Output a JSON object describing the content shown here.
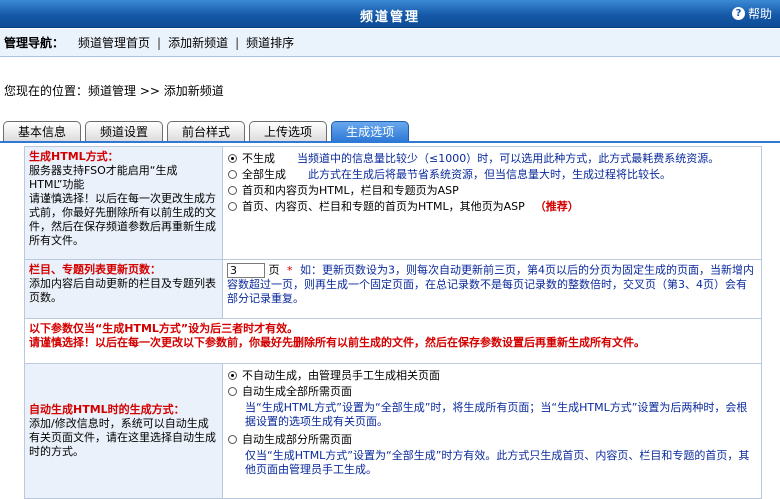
{
  "header": {
    "title": "频道管理",
    "help_label": "帮助"
  },
  "nav": {
    "label": "管理导航：",
    "links": [
      "频道管理首页",
      "添加新频道",
      "频道排序"
    ]
  },
  "location": "您现在的位置：频道管理 >> 添加新频道",
  "tabs": [
    "基本信息",
    "频道设置",
    "前台样式",
    "上传选项",
    "生成选项"
  ],
  "active_tab": "生成选项",
  "html_mode": {
    "title": "生成HTML方式：",
    "desc": "服务器支持FSO才能启用“生成HTML”功能\n请谨慎选择！以后在每一次更改生成方式前，你最好先删除所有以前生成的文件，然后在保存频道参数后再重新生成所有文件。",
    "options": [
      {
        "label": "不生成",
        "desc": "当频道中的信息量比较少（≤1000）时，可以选用此种方式，此方式最耗费系统资源。",
        "checked": true
      },
      {
        "label": "全部生成",
        "desc": "此方式在生成后将最节省系统资源，但当信息量大时，生成过程将比较长。",
        "checked": false
      },
      {
        "label": "首页和内容页为HTML，栏目和专题页为ASP",
        "desc": "",
        "checked": false
      },
      {
        "label": "首页、内容页、栏目和专题的首页为HTML，其他页为ASP",
        "desc": "",
        "recommend": "（推荐）",
        "checked": false
      }
    ]
  },
  "update_pages": {
    "title": "栏目、专题列表更新页数：",
    "desc": "添加内容后自动更新的栏目及专题列表页数。",
    "value": "3",
    "unit": "页",
    "star": "*",
    "note": "如：更新页数设为3，则每次自动更新前三页，第4页以后的分页为固定生成的页面，当新增内容数超过一页，则再生成一个固定页面，在总记录数不是每页记录数的整数倍时，交叉页（第3、4页）会有部分记录重复。"
  },
  "notice": {
    "line1": "以下参数仅当“生成HTML方式”设为后三者时才有效。",
    "line2": "请谨慎选择！以后在每一次更改以下参数前，你最好先删除所有以前生成的文件，然后在保存参数设置后再重新生成所有文件。"
  },
  "auto_mode": {
    "title": "自动生成HTML时的生成方式：",
    "desc": "添加/修改信息时，系统可以自动生成有关页面文件，请在这里选择自动生成时的方式。",
    "options": [
      {
        "label": "不自动生成，由管理员手工生成相关页面",
        "desc": "",
        "checked": true
      },
      {
        "label": "自动生成全部所需页面",
        "desc": "当“生成HTML方式”设置为“全部生成”时，将生成所有页面；当“生成HTML方式”设置为后两种时，会根据设置的选项生成有关页面。",
        "checked": false
      },
      {
        "label": "自动生成部分所需页面",
        "desc": "仅当“生成HTML方式”设置为“全部生成”时方有效。此方式只生成首页、内容页、栏目和专题的首页，其他页面由管理员手工生成。",
        "checked": false
      }
    ]
  }
}
